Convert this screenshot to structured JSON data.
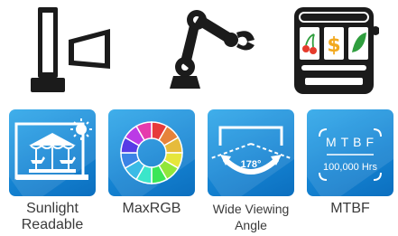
{
  "top_icons": [
    {
      "name": "kiosk-display-icon",
      "color": "#1b1b1b"
    },
    {
      "name": "robotic-arm-icon",
      "color": "#1b1b1b"
    },
    {
      "name": "slot-machine-icon",
      "color": "#1b1b1b"
    }
  ],
  "features": [
    {
      "icon": "carousel-sun-icon",
      "caption_lines": [
        "Sunlight",
        "Readable"
      ]
    },
    {
      "icon": "color-wheel-icon",
      "caption_lines": [
        "MaxRGB"
      ]
    },
    {
      "icon": "viewing-angle-icon",
      "caption_lines": [
        "Wide Viewing",
        "Angle"
      ],
      "angle_label": "178°"
    },
    {
      "icon": "mtbf-icon",
      "caption_lines": [
        "MTBF"
      ],
      "tile_title": "MTBF",
      "tile_value": "100,000 Hrs"
    }
  ],
  "colors": {
    "tile_blue": "#1a8ad8",
    "icon_dark": "#1b1b1b",
    "slot_red": "#e53b2c",
    "slot_gold": "#f2a91f",
    "slot_green": "#2f9e3e"
  }
}
